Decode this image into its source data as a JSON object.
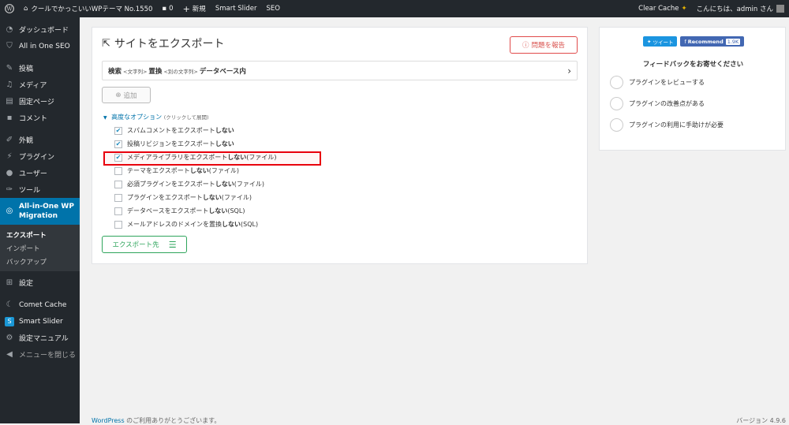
{
  "adminbar": {
    "site": "クールでかっこいいWPテーマ No.1550",
    "comments": "0",
    "new": "新規",
    "slider": "Smart Slider",
    "seo": "SEO",
    "cache": "Clear Cache",
    "greeting": "こんにちは、admin さん"
  },
  "sidebar": {
    "items": [
      {
        "label": "ダッシュボード",
        "icon": "dashboard-icon"
      },
      {
        "label": "All in One SEO",
        "icon": "shield-icon"
      },
      {
        "label": "投稿",
        "icon": "pin-icon"
      },
      {
        "label": "メディア",
        "icon": "media-icon"
      },
      {
        "label": "固定ページ",
        "icon": "page-icon"
      },
      {
        "label": "コメント",
        "icon": "comment-icon"
      },
      {
        "label": "外観",
        "icon": "brush-icon"
      },
      {
        "label": "プラグイン",
        "icon": "plugin-icon"
      },
      {
        "label": "ユーザー",
        "icon": "user-icon"
      },
      {
        "label": "ツール",
        "icon": "wrench-icon"
      },
      {
        "label": "All-in-One WP Migration",
        "icon": "migration-icon"
      },
      {
        "label": "設定",
        "icon": "settings-icon"
      },
      {
        "label": "Comet Cache",
        "icon": "comet-icon"
      },
      {
        "label": "Smart Slider",
        "icon": "slider-icon"
      },
      {
        "label": "設定マニュアル",
        "icon": "gear-icon"
      },
      {
        "label": "メニューを閉じる",
        "icon": "collapse-icon"
      }
    ],
    "sub": [
      "エクスポート",
      "インポート",
      "バックアップ"
    ]
  },
  "main": {
    "title": "サイトをエクスポート",
    "report": "問題を報告",
    "find": {
      "a": "検索",
      "a_small": "<文字列>",
      "b": "置換",
      "b_small": "<別の文字列>",
      "c": "データベース内"
    },
    "add": "追加",
    "adv": "高度なオプション",
    "adv_small": "(クリックして展開)",
    "options": [
      {
        "pre": "スパムコメントをエクスポート",
        "bold": "しない",
        "post": "",
        "checked": true
      },
      {
        "pre": "投稿リビジョンをエクスポート",
        "bold": "しない",
        "post": "",
        "checked": true
      },
      {
        "pre": "メディアライブラリをエクスポート",
        "bold": "しない",
        "post": " (ファイル)",
        "checked": true
      },
      {
        "pre": "テーマをエクスポート",
        "bold": "しない",
        "post": " (ファイル)",
        "checked": false
      },
      {
        "pre": "必須プラグインをエクスポート",
        "bold": "しない",
        "post": " (ファイル)",
        "checked": false
      },
      {
        "pre": "プラグインをエクスポート",
        "bold": "しない",
        "post": " (ファイル)",
        "checked": false
      },
      {
        "pre": "データベースをエクスポート",
        "bold": "しない",
        "post": " (SQL)",
        "checked": false
      },
      {
        "pre": "メールアドレスのドメインを置換",
        "bold": "しない",
        "post": " (SQL)",
        "checked": false
      }
    ],
    "export": "エクスポート先"
  },
  "side": {
    "tweet": "ツイート",
    "recommend": "Recommend",
    "count": "1.9K",
    "title": "フィードバックをお寄せください",
    "options": [
      "プラグインをレビューする",
      "プラグインの改善点がある",
      "プラグインの利用に手助けが必要"
    ]
  },
  "footer": {
    "link": "WordPress",
    "text": " のご利用ありがとうございます。",
    "version": "バージョン 4.9.6"
  }
}
